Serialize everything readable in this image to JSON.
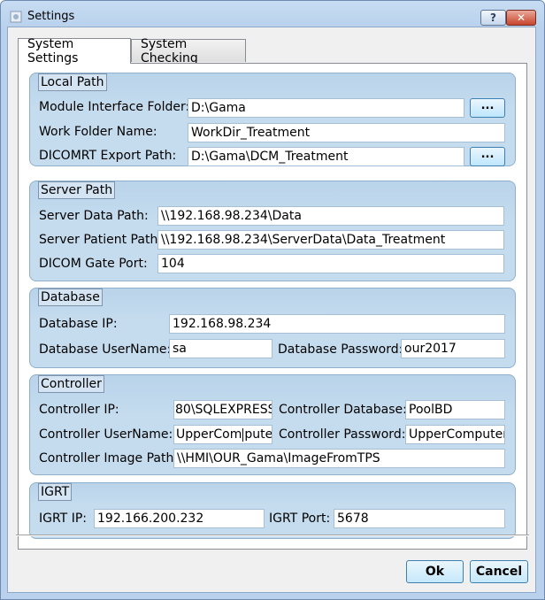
{
  "window": {
    "title": "Settings",
    "help_label": "?",
    "close_label": "✕"
  },
  "tabs": [
    {
      "label": "System Settings",
      "active": true
    },
    {
      "label": "System Checking",
      "active": false
    }
  ],
  "local_path": {
    "title": "Local Path",
    "module_label": "Module Interface Folder:",
    "module_value": "D:\\Gama",
    "work_label": "Work Folder Name:",
    "work_value": "WorkDir_Treatment",
    "export_label": "DICOMRT Export Path:",
    "export_value": "D:\\Gama\\DCM_Treatment",
    "browse_label": "..."
  },
  "server_path": {
    "title": "Server Path",
    "data_label": "Server Data Path:",
    "data_value": "\\\\192.168.98.234\\Data",
    "patient_label": "Server Patient Path:",
    "patient_value": "\\\\192.168.98.234\\ServerData\\Data_Treatment",
    "port_label": "DICOM Gate Port:",
    "port_value": "104"
  },
  "database": {
    "title": "Database",
    "ip_label": "Database IP:",
    "ip_value": "192.168.98.234",
    "user_label": "Database UserName:",
    "user_value": "sa",
    "password_label": "Database Password:",
    "password_value": "our2017"
  },
  "controller": {
    "title": "Controller",
    "ip_label": "Controller IP:",
    "ip_value": "80\\SQLEXPRESS",
    "database_label": "Controller Database:",
    "database_value": "PoolBD",
    "user_label": "Controller UserName:",
    "user_value_a": "UpperCom",
    "user_value_b": "puter",
    "password_label": "Controller Password:",
    "password_value": "UpperComputer",
    "image_label": "Controller Image Path:",
    "image_value": "\\\\HMI\\OUR_Gama\\ImageFromTPS"
  },
  "igrt": {
    "title": "IGRT",
    "ip_label": "IGRT IP:",
    "ip_value": "192.166.200.232",
    "port_label": "IGRT Port:",
    "port_value": "5678"
  },
  "buttons": {
    "ok": "Ok",
    "cancel": "Cancel"
  },
  "icons": {
    "app": "settings-app-icon",
    "help": "help-icon",
    "close": "close-icon"
  }
}
